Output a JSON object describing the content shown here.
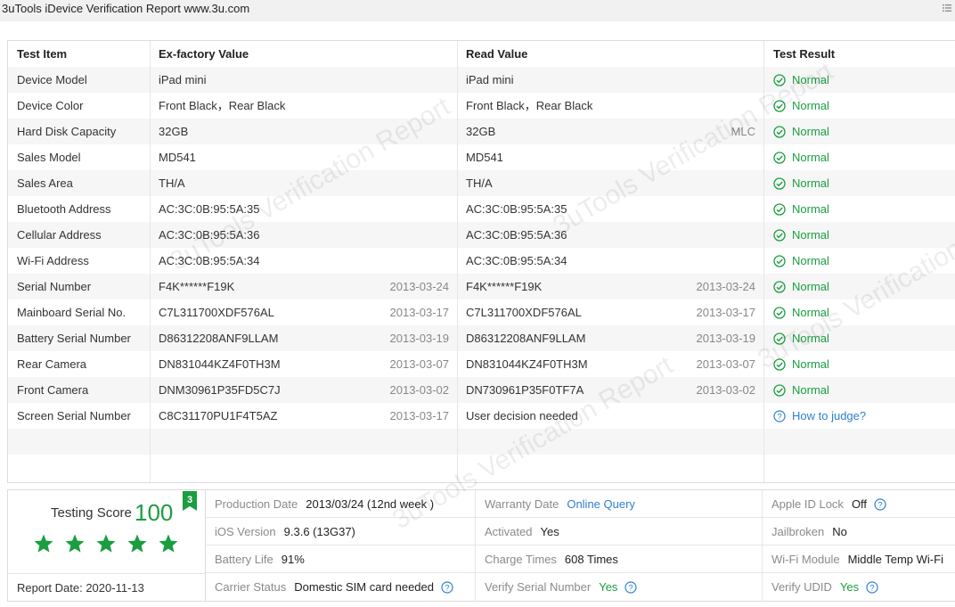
{
  "window": {
    "title": "3uTools iDevice Verification Report www.3u.com",
    "menu_icon": "list-icon"
  },
  "table": {
    "headers": [
      "Test Item",
      "Ex-factory Value",
      "Read Value",
      "Test Result"
    ],
    "rows": [
      {
        "item": "Device Model",
        "ex": "iPad mini",
        "ex_date": "",
        "read": "iPad mini",
        "read_date": "",
        "result": "Normal"
      },
      {
        "item": "Device Color",
        "ex": "Front Black，Rear Black",
        "ex_date": "",
        "read": "Front Black，Rear Black",
        "read_date": "",
        "result": "Normal"
      },
      {
        "item": "Hard Disk Capacity",
        "ex": "32GB",
        "ex_date": "",
        "read": "32GB",
        "read_date": "MLC",
        "result": "Normal"
      },
      {
        "item": "Sales Model",
        "ex": "MD541",
        "ex_date": "",
        "read": "MD541",
        "read_date": "",
        "result": "Normal"
      },
      {
        "item": "Sales Area",
        "ex": "TH/A",
        "ex_date": "",
        "read": "TH/A",
        "read_date": "",
        "result": "Normal"
      },
      {
        "item": "Bluetooth Address",
        "ex": "AC:3C:0B:95:5A:35",
        "ex_date": "",
        "read": "AC:3C:0B:95:5A:35",
        "read_date": "",
        "result": "Normal"
      },
      {
        "item": "Cellular Address",
        "ex": "AC:3C:0B:95:5A:36",
        "ex_date": "",
        "read": "AC:3C:0B:95:5A:36",
        "read_date": "",
        "result": "Normal"
      },
      {
        "item": "Wi-Fi Address",
        "ex": "AC:3C:0B:95:5A:34",
        "ex_date": "",
        "read": "AC:3C:0B:95:5A:34",
        "read_date": "",
        "result": "Normal"
      },
      {
        "item": "Serial Number",
        "ex": "F4K******F19K",
        "ex_date": "2013-03-24",
        "read": "F4K******F19K",
        "read_date": "2013-03-24",
        "result": "Normal"
      },
      {
        "item": "Mainboard Serial No.",
        "ex": "C7L311700XDF576AL",
        "ex_date": "2013-03-17",
        "read": "C7L311700XDF576AL",
        "read_date": "2013-03-17",
        "result": "Normal"
      },
      {
        "item": "Battery Serial Number",
        "ex": "D86312208ANF9LLAM",
        "ex_date": "2013-03-19",
        "read": "D86312208ANF9LLAM",
        "read_date": "2013-03-19",
        "result": "Normal"
      },
      {
        "item": "Rear Camera",
        "ex": "DN831044KZ4F0TH3M",
        "ex_date": "2013-03-07",
        "read": "DN831044KZ4F0TH3M",
        "read_date": "2013-03-07",
        "result": "Normal"
      },
      {
        "item": "Front Camera",
        "ex": "DNM30961P35FD5C7J",
        "ex_date": "2013-03-02",
        "read": "DN730961P35F0TF7A",
        "read_date": "2013-03-02",
        "result": "Normal"
      },
      {
        "item": "Screen Serial Number",
        "ex": "C8C31170PU1F4T5AZ",
        "ex_date": "2013-03-17",
        "read": "User decision needed",
        "read_date": "",
        "result": "How to judge?"
      }
    ]
  },
  "score": {
    "label": "Testing Score",
    "value": "100",
    "badge": "3",
    "stars": 5,
    "report_date_label": "Report Date:",
    "report_date": "2020-11-13"
  },
  "info": [
    [
      {
        "label": "Production Date",
        "value": "2013/03/24 (12nd week )"
      },
      {
        "label": "Warranty Date",
        "value": "Online Query",
        "style": "link"
      },
      {
        "label": "Apple ID Lock",
        "value": "Off",
        "help": true
      }
    ],
    [
      {
        "label": "iOS Version",
        "value": "9.3.6 (13G37)"
      },
      {
        "label": "Activated",
        "value": "Yes"
      },
      {
        "label": "Jailbroken",
        "value": "No"
      }
    ],
    [
      {
        "label": "Battery Life",
        "value": "91%"
      },
      {
        "label": "Charge Times",
        "value": "608 Times"
      },
      {
        "label": "Wi-Fi Module",
        "value": "Middle Temp Wi-Fi"
      }
    ],
    [
      {
        "label": "Carrier Status",
        "value": "Domestic SIM card needed",
        "help": true
      },
      {
        "label": "Verify Serial Number",
        "value": "Yes",
        "style": "green",
        "help": true
      },
      {
        "label": "Verify UDID",
        "value": "Yes",
        "style": "green",
        "help": true
      }
    ]
  ],
  "colors": {
    "ok": "#1a9e3f",
    "link": "#2f7fd1",
    "label": "#8a8a8a"
  }
}
